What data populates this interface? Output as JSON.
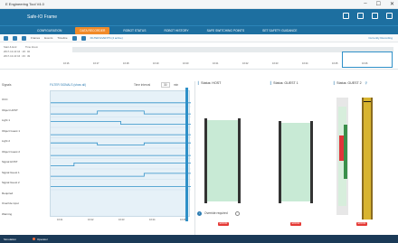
{
  "window": {
    "title": "E Engineering Tool V4.0",
    "controls": [
      "–",
      "☐",
      "✕"
    ]
  },
  "appbar": {
    "brand": "Safe-IO Frame"
  },
  "tabs": [
    {
      "label": "CONFIGURATION",
      "active": false
    },
    {
      "label": "DATA RECORDER",
      "active": true
    },
    {
      "label": "ROBOT STATUS",
      "active": false
    },
    {
      "label": "ROBOT HISTORY",
      "active": false
    },
    {
      "label": "SAFE SWITCHING POINTS",
      "active": false
    },
    {
      "label": "SET SAFETY GUIDANCE",
      "active": false
    }
  ],
  "toolbar": {
    "frames_label": "Frames",
    "events_label": "Events",
    "timeline_label": "Timeline",
    "filter_label": "FILTER EVENTS (4 active)",
    "right_label": "Currently Recording"
  },
  "timeline": {
    "labels": [
      "Start & End",
      "Time Zoom"
    ],
    "start": "2017-10-10  16 : 18 : 02",
    "end": "2017-10-10  16 : 29 : 49",
    "times": [
      "16:16",
      "16:17",
      "16:18",
      "16:19",
      "16:20",
      "16:21",
      "16:22",
      "16:23",
      "16:24",
      "16:25",
      "16:26"
    ]
  },
  "leftpane": {
    "signals_label": "Signals",
    "filter": "FILTER SIGNALS (show all)",
    "time_label": "Time interval",
    "interval_value": "30",
    "interval_unit": "min"
  },
  "signals": [
    "OCC",
    "Object HOST",
    "Light 1",
    "Object Guest 1",
    "Light 2",
    "Object Guest 2",
    "Signal HOST",
    "Signal Guest 1",
    "Signal Guest 2",
    "Required",
    "Override input",
    "Warning"
  ],
  "signal_traces": [
    [
      0.4,
      0.4,
      0.4,
      0.4,
      0.4,
      0.4
    ],
    [
      0.3,
      0.3,
      0.7,
      0.7,
      0.3,
      0.3
    ],
    [
      0.7,
      0.7,
      0.7,
      0.3,
      0.3,
      0.3
    ],
    [
      0.3,
      0.3,
      0.3,
      0.3,
      0.3,
      0.3
    ],
    [
      0.6,
      0.6,
      0.3,
      0.3,
      0.6,
      0.6
    ],
    [
      0.3,
      0.3,
      0.3,
      0.3,
      0.3,
      0.3
    ],
    [
      0.3,
      0.7,
      0.7,
      0.7,
      0.7,
      0.7
    ],
    [
      0.3,
      0.3,
      0.3,
      0.3,
      0.7,
      0.7
    ],
    [
      0.3,
      0.3,
      0.3,
      0.3,
      0.3,
      0.3
    ]
  ],
  "xaxis": [
    "16:21",
    "16:22",
    "16:23",
    "16:24",
    "16:25"
  ],
  "status_columns": [
    {
      "title": "Status: HOST",
      "badge": "ERROR"
    },
    {
      "title": "Status: GUEST 1",
      "badge": "ERROR"
    },
    {
      "title": "Status: GUEST 2",
      "badge": "ERROR"
    }
  ],
  "override": {
    "label": "Override required"
  },
  "statusbar": {
    "items": [
      "Simulation",
      "Operator"
    ]
  },
  "colors": {
    "brand": "#1d6fa0",
    "accent": "#f08a29",
    "error": "#e53935",
    "light_green": "#9bd8b3",
    "status_bg": "#1b3a57"
  }
}
